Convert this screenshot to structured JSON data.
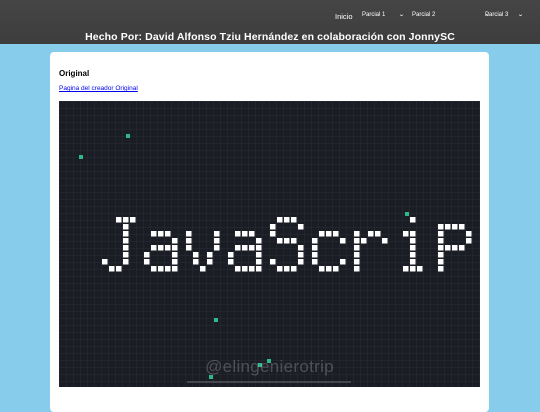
{
  "header": {
    "nav": {
      "inicio": "Inicio",
      "parcial1": "Parcial 1",
      "parcial2": "Parcial 2",
      "parcial3": "Parcial 3"
    },
    "title": "Hecho Por: David Alfonso Tziu Hernández en colaboración con JonnySC"
  },
  "card": {
    "heading": "Original",
    "link_label": "Pagina del creador Original"
  },
  "demo": {
    "text": "JavaScript",
    "watermark": "@elingenierotrip",
    "colors": {
      "background": "#1b1d24",
      "grid": "#2b2e36",
      "pixel": "#ffffff",
      "accent": "#2fd39a"
    }
  }
}
